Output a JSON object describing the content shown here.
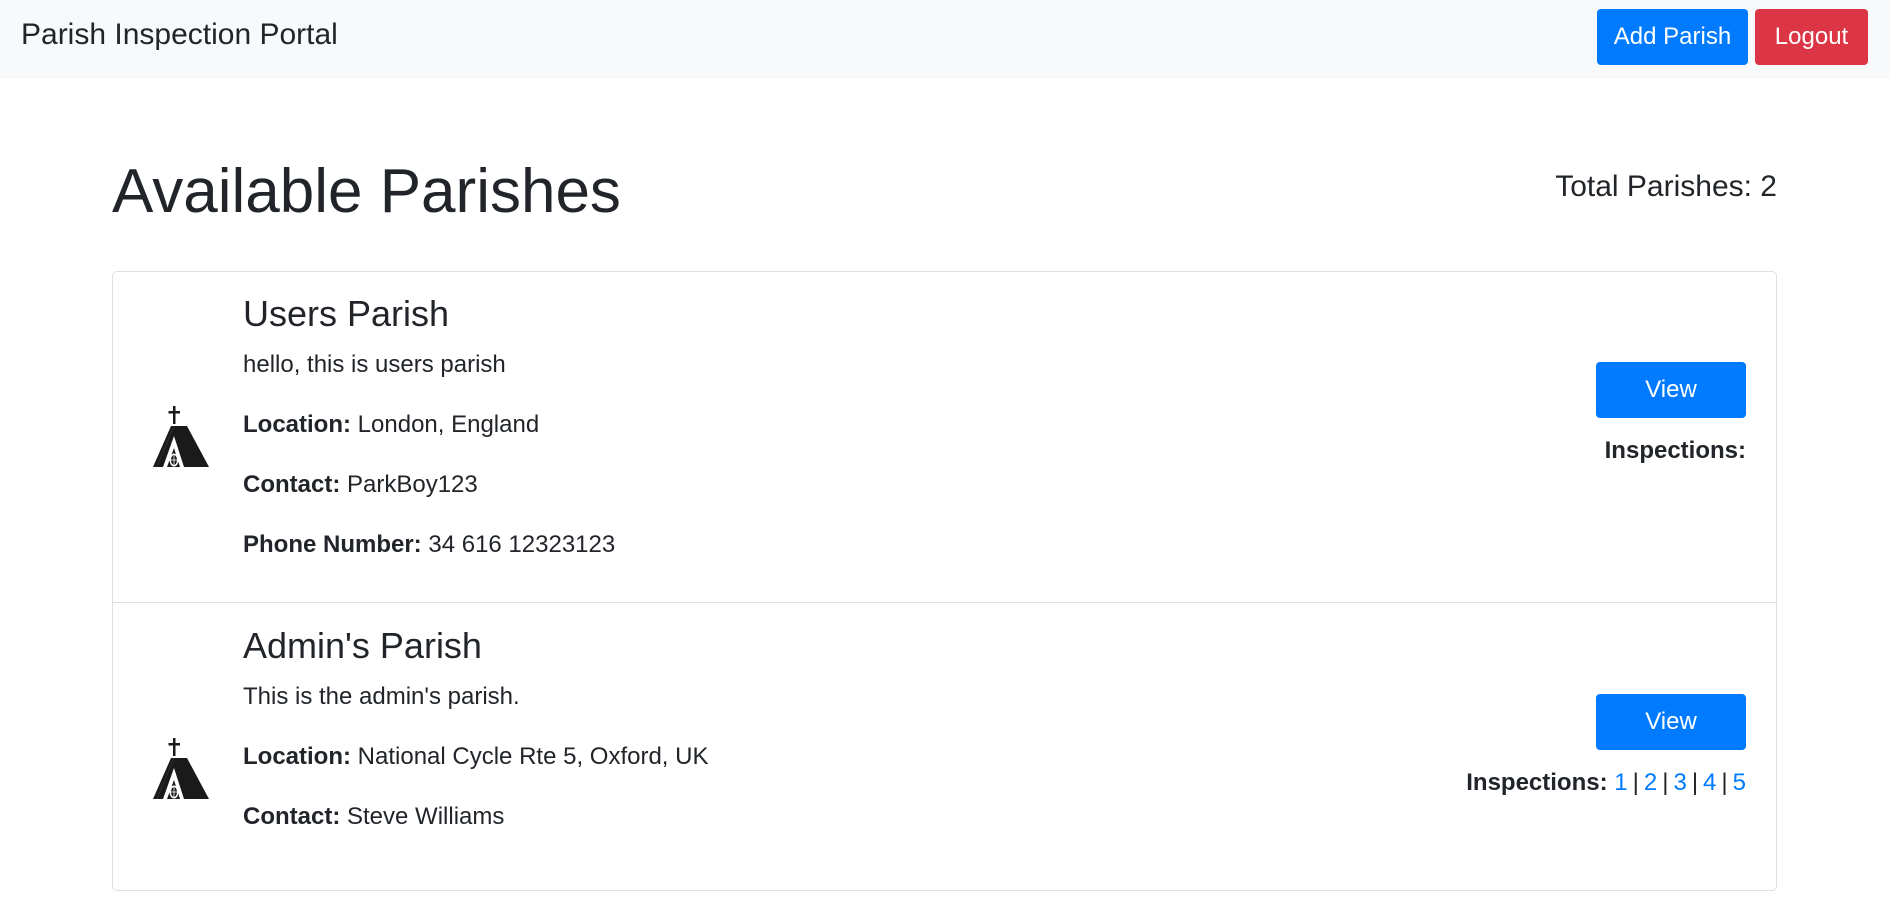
{
  "navbar": {
    "brand": "Parish Inspection Portal",
    "add_parish_label": "Add Parish",
    "logout_label": "Logout"
  },
  "page": {
    "title": "Available Parishes",
    "total_label": "Total Parishes: 2"
  },
  "labels": {
    "location": "Location:",
    "contact": "Contact:",
    "phone": "Phone Number:",
    "view": "View",
    "inspections": "Inspections:"
  },
  "parishes": [
    {
      "name": "Users Parish",
      "description": "hello, this is users parish",
      "location": "London, England",
      "contact": "ParkBoy123",
      "phone": "34 616 12323123",
      "inspections": []
    },
    {
      "name": "Admin's Parish",
      "description": "This is the admin's parish.",
      "location": "National Cycle Rte 5, Oxford, UK",
      "contact": "Steve Williams",
      "inspections": [
        "1",
        "2",
        "3",
        "4",
        "5"
      ]
    }
  ],
  "colors": {
    "primary": "#007bff",
    "danger": "#dc3545",
    "navbar_bg": "#f8f9fa",
    "text": "#212529"
  },
  "icons": {
    "parish": "church-icon"
  }
}
